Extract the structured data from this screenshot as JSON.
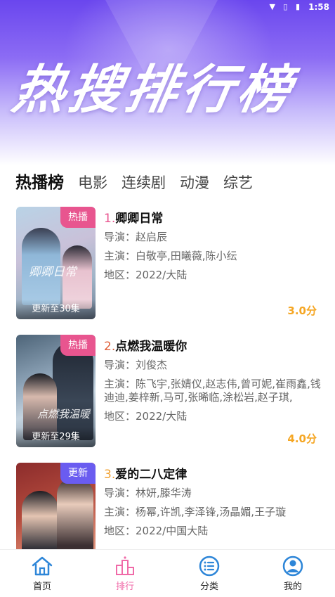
{
  "status_bar": {
    "time": "1:58",
    "icons": "wifi signal battery"
  },
  "hero": {
    "title": "热搜排行榜"
  },
  "tabs": [
    {
      "label": "热播榜",
      "active": true
    },
    {
      "label": "电影"
    },
    {
      "label": "连续剧"
    },
    {
      "label": "动漫"
    },
    {
      "label": "综艺"
    }
  ],
  "list": [
    {
      "rank": "1.",
      "title": "卿卿日常",
      "tag": "热播",
      "update": "更新至30集",
      "poster_text": "卿卿日常",
      "director": "导演：赵启辰",
      "cast": "主演：白敬亭,田曦薇,陈小纭",
      "region": "地区：2022/大陆",
      "score": "3.0分"
    },
    {
      "rank": "2.",
      "title": "点燃我温暖你",
      "tag": "热播",
      "update": "更新至29集",
      "poster_text": "点燃我温暖",
      "director": "导演：刘俊杰",
      "cast": "主演：陈飞宇,张婧仪,赵志伟,曾可妮,崔雨鑫,钱迪迪,姜梓新,马可,张晞临,涂松岩,赵子琪,",
      "region": "地区：2022/大陆",
      "score": "4.0分"
    },
    {
      "rank": "3.",
      "title": "爱的二八定律",
      "tag": "更新",
      "director": "导演：林妍,滕华涛",
      "cast": "主演：杨幂,许凯,李泽锋,汤晶媚,王子璇",
      "region": "地区：2022/中国大陆"
    }
  ],
  "tabbar": [
    {
      "label": "首页",
      "icon": "home-icon"
    },
    {
      "label": "排行",
      "icon": "ranking-icon",
      "active": true
    },
    {
      "label": "分类",
      "icon": "category-icon"
    },
    {
      "label": "我的",
      "icon": "profile-icon"
    }
  ],
  "colors": {
    "accent": "#f06aa8",
    "score": "#f5a623",
    "hot_tag": "#e8558f",
    "update_tag": "#6a5cf0",
    "tabbar_icon": "#2e86d8"
  }
}
